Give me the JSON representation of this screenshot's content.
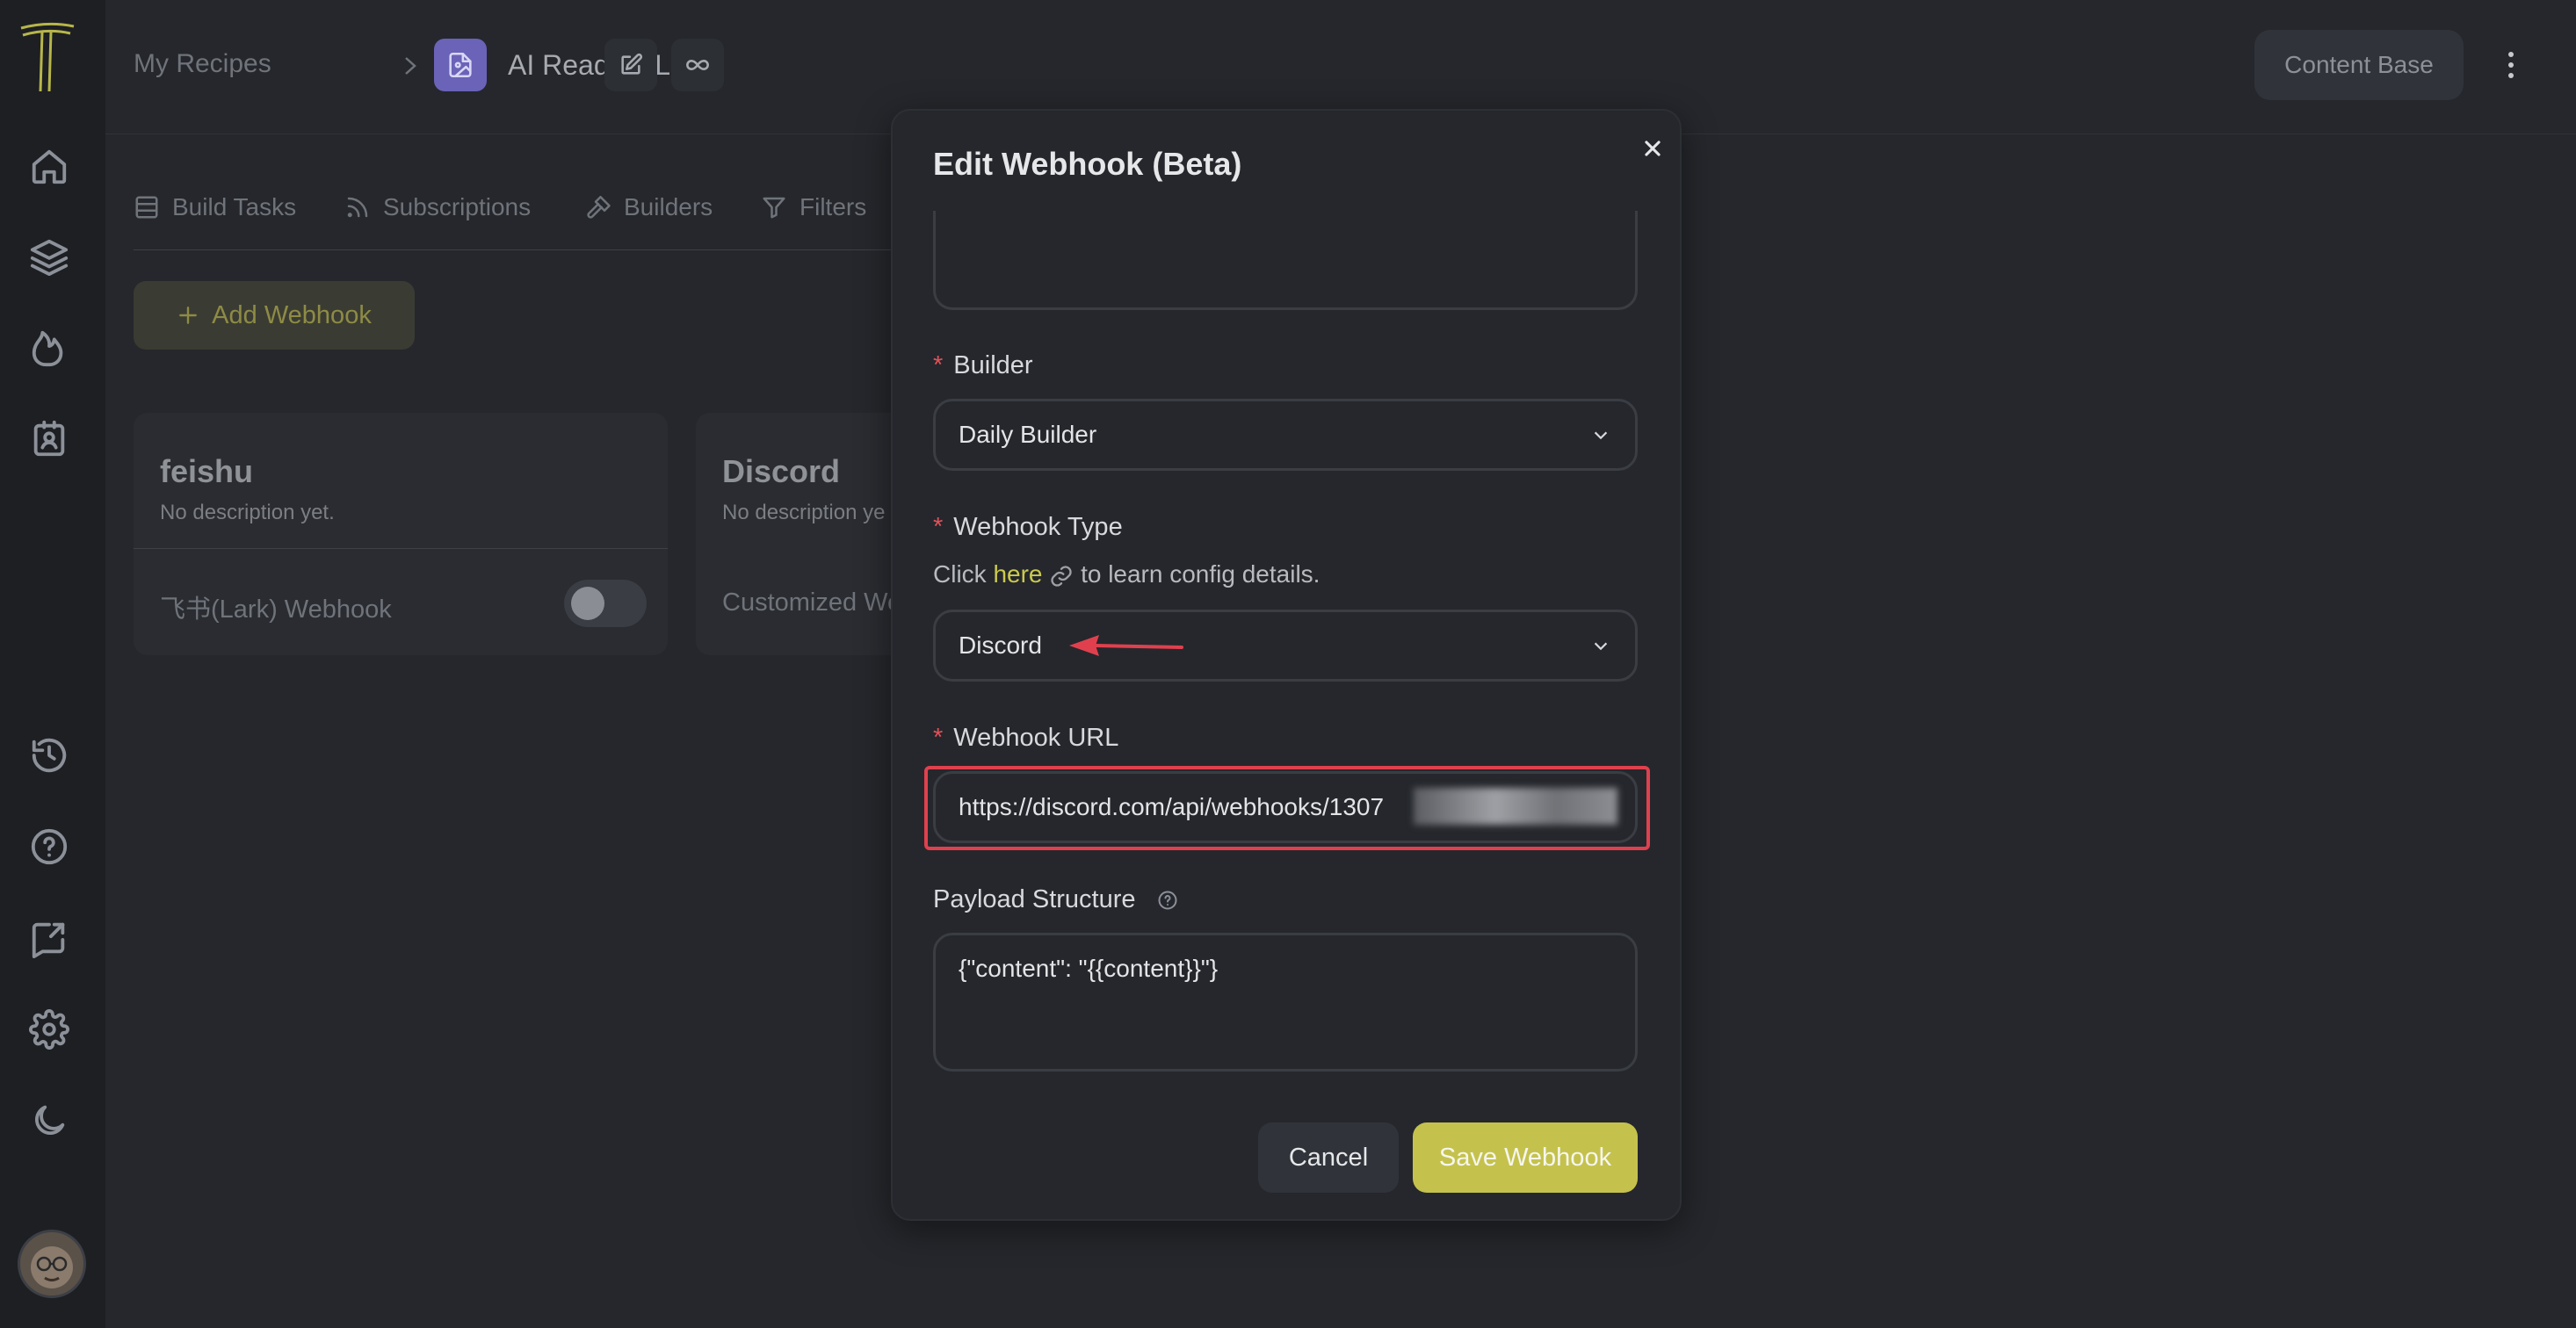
{
  "breadcrumb": {
    "root": "My Recipes",
    "recipe_title": "AI Reading List"
  },
  "header": {
    "content_base_label": "Content Base"
  },
  "tabs": [
    {
      "label": "Build Tasks",
      "icon": "table-icon"
    },
    {
      "label": "Subscriptions",
      "icon": "rss-icon"
    },
    {
      "label": "Builders",
      "icon": "hammer-icon"
    },
    {
      "label": "Filters",
      "icon": "filter-icon"
    }
  ],
  "add_webhook_label": "Add Webhook",
  "cards": [
    {
      "title": "feishu",
      "description": "No description yet.",
      "type": "飞书(Lark) Webhook",
      "enabled": false
    },
    {
      "title": "Discord",
      "description": "No description ye",
      "type": "Customized We"
    }
  ],
  "modal": {
    "title": "Edit Webhook (Beta)",
    "builder": {
      "label": "Builder",
      "value": "Daily Builder"
    },
    "webhook_type": {
      "label": "Webhook Type",
      "help_prefix": "Click",
      "help_link": "here",
      "help_suffix": "to learn config details.",
      "value": "Discord"
    },
    "webhook_url": {
      "label": "Webhook URL",
      "value": "https://discord.com/api/webhooks/1307"
    },
    "payload": {
      "label": "Payload Structure",
      "value": "{\"content\": \"{{content}}\"}"
    },
    "cancel_label": "Cancel",
    "save_label": "Save Webhook"
  },
  "colors": {
    "accent": "#c4c24d",
    "annotation_red": "#e0404e",
    "background": "#25272c",
    "sidebar": "#1d1f23"
  }
}
